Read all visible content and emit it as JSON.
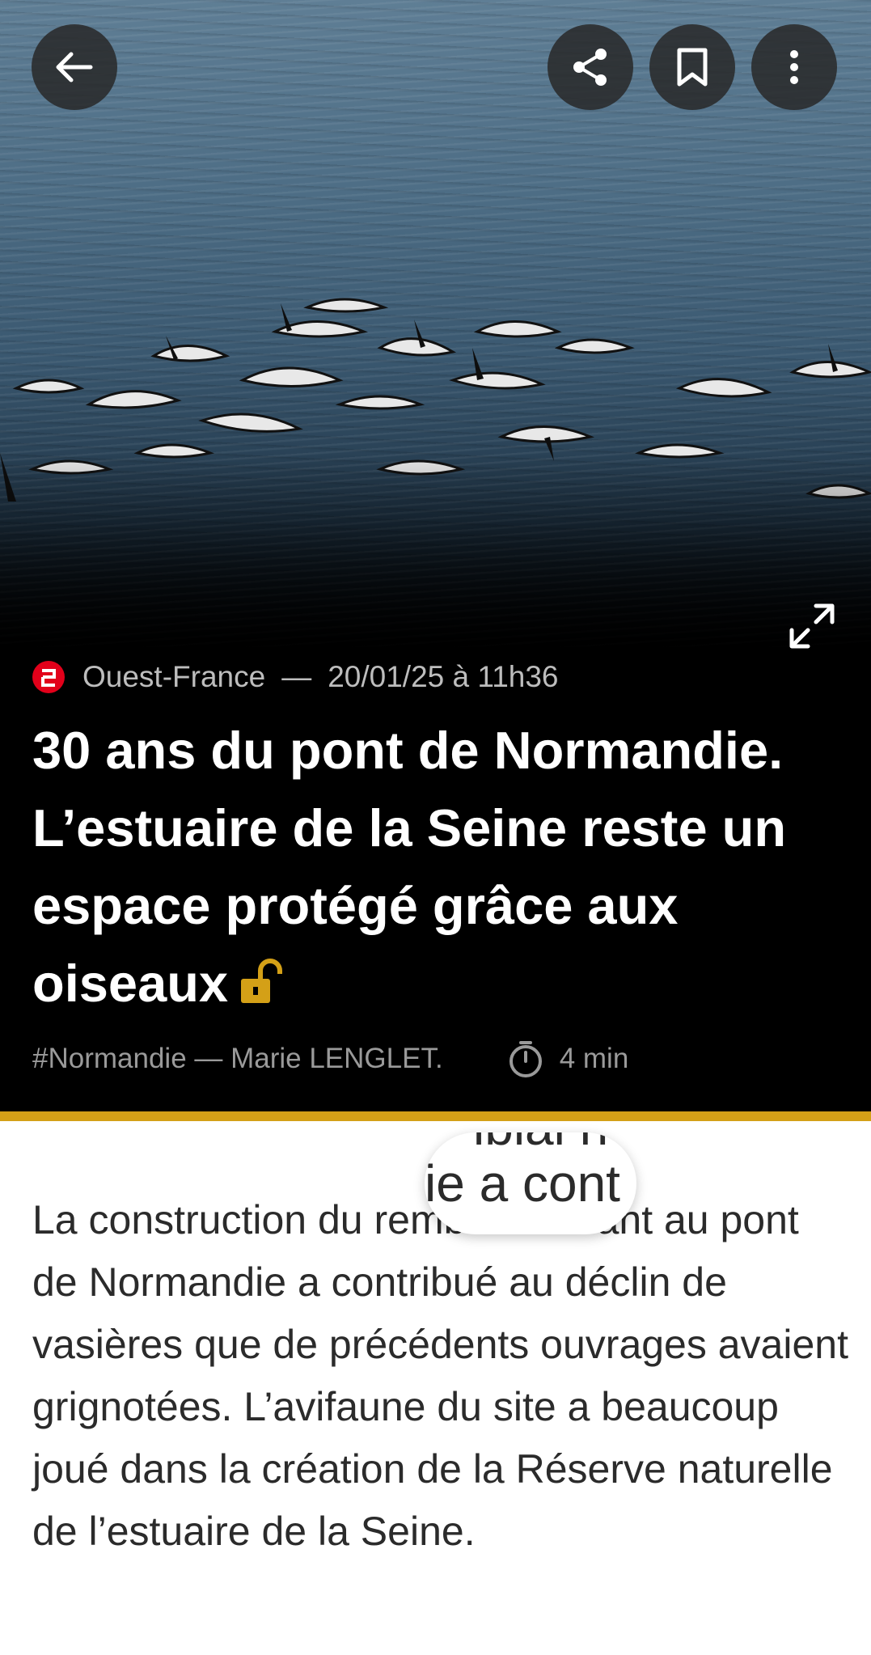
{
  "toolbar": {
    "back_icon": "arrow-left-icon",
    "share_icon": "share-icon",
    "bookmark_icon": "bookmark-icon",
    "more_icon": "more-vertical-icon",
    "expand_icon": "expand-icon"
  },
  "article": {
    "source": "Ouest-France",
    "separator": "—",
    "date": "20/01/25 à 11h36",
    "headline": "30 ans du pont de Normandie. L’estuaire de la Seine reste un espace protégé grâce aux oiseaux",
    "tags_author": "#Normandie — Marie LENGLET.",
    "read_time": "4 min",
    "lock_icon": "unlocked-padlock-icon",
    "lock_color": "#d4a017",
    "accent_color": "#d4a017",
    "source_logo_color": "#e2001a",
    "body": "La construction du remblai menant au pont de Normandie a contribué au déclin de vasières que de précédents ouvrages avaient grignotées. L’avifaune du site a beaucoup joué dans la création de la Réserve naturelle de l’estuaire de la Seine."
  },
  "magnifier": {
    "text": "ie a cont",
    "top_text": "iblai n"
  }
}
